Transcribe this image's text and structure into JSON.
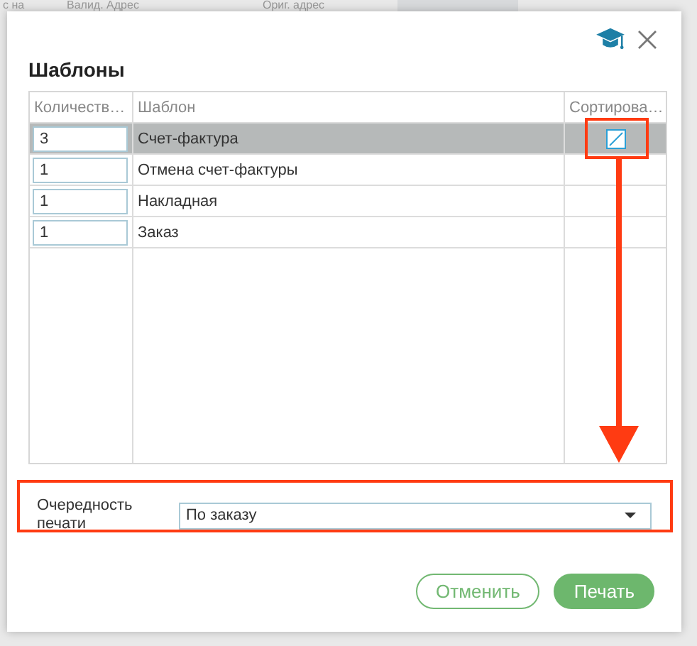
{
  "background": {
    "headers": [
      "с на",
      "Валид. Адрес",
      "Ориг. адрес"
    ]
  },
  "dialog": {
    "title": "Шаблоны",
    "table": {
      "columns": [
        "Количеств…",
        "Шаблон",
        "Сортирова…"
      ],
      "rows": [
        {
          "quantity": "3",
          "template": "Счет-фактура",
          "selected": true,
          "checked": false
        },
        {
          "quantity": "1",
          "template": "Отмена счет-фактуры",
          "selected": false,
          "checked": false
        },
        {
          "quantity": "1",
          "template": "Накладная",
          "selected": false,
          "checked": false
        },
        {
          "quantity": "1",
          "template": "Заказ",
          "selected": false,
          "checked": false
        }
      ]
    },
    "print_order": {
      "label": "Очередность печати",
      "value": "По заказу"
    },
    "buttons": [
      {
        "label": "Отменить",
        "kind": "secondary"
      },
      {
        "label": "Печать",
        "kind": "primary"
      }
    ]
  }
}
